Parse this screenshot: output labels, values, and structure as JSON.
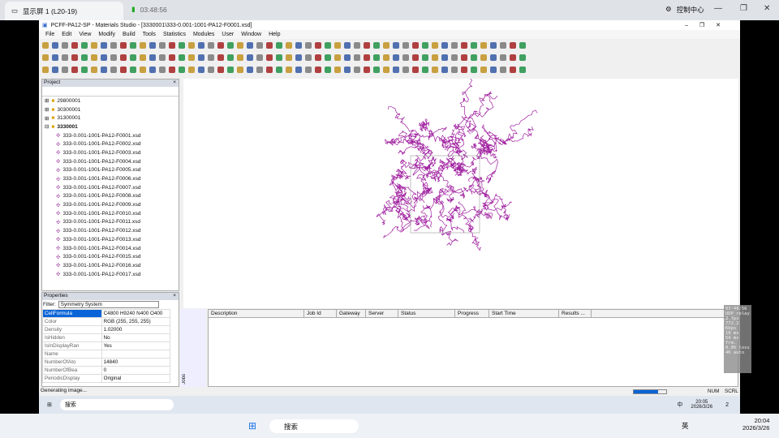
{
  "host": {
    "tab_label": "显示屏 1 (L20-19)",
    "tab_time": "03:48:56",
    "control_center": "控制中心",
    "clock_time": "20:04",
    "clock_date": "2026/3/26",
    "lang": "英"
  },
  "window": {
    "title": "PCFF-PA12-SP - Materials Studio - [3330001\\333-0.001-1001-PA12-F0001.xsd]",
    "menu": [
      "File",
      "Edit",
      "View",
      "Modify",
      "Build",
      "Tools",
      "Statistics",
      "Modules",
      "User",
      "Window",
      "Help"
    ]
  },
  "project": {
    "title": "Project",
    "folders": [
      "29800001",
      "30300001",
      "31300001",
      "3330001"
    ],
    "files": [
      "333-0.001-1001-PA12-F0001.xsd",
      "333-0.001-1001-PA12-F0002.xsd",
      "333-0.001-1001-PA12-F0003.xsd",
      "333-0.001-1001-PA12-F0004.xsd",
      "333-0.001-1001-PA12-F0005.xsd",
      "333-0.001-1001-PA12-F0006.xsd",
      "333-0.001-1001-PA12-F0007.xsd",
      "333-0.001-1001-PA12-F0008.xsd",
      "333-0.001-1001-PA12-F0009.xsd",
      "333-0.001-1001-PA12-F0010.xsd",
      "333-0.001-1001-PA12-F0011.xsd",
      "333-0.001-1001-PA12-F0012.xsd",
      "333-0.001-1001-PA12-F0013.xsd",
      "333-0.001-1001-PA12-F0014.xsd",
      "333-0.001-1001-PA12-F0015.xsd",
      "333-0.001-1001-PA12-F0016.xsd",
      "333-0.001-1001-PA12-F0017.xsd"
    ]
  },
  "properties": {
    "title": "Properties",
    "filter_label": "Filter:",
    "filter_value": "Symmetry System",
    "rows": [
      [
        "CellFormula",
        "C4800 H9240 N400 O400"
      ],
      [
        "Color",
        "RGB (255, 255, 255)"
      ],
      [
        "Density",
        "1.02000"
      ],
      [
        "IsHidden",
        "No"
      ],
      [
        "IsInDisplayRan",
        "Yes"
      ],
      [
        "Name",
        ""
      ],
      [
        "NumberOfAto",
        "14840"
      ],
      [
        "NumberOfBea",
        "0"
      ],
      [
        "PeriodicDisplay",
        "Original"
      ]
    ]
  },
  "jobs": {
    "tab": "Jobs",
    "columns": [
      "Description",
      "Job Id",
      "Gateway",
      "Server",
      "Status",
      "Progress",
      "Start Time",
      "Results ..."
    ]
  },
  "status": {
    "text": "Generating image...",
    "num": "NUM",
    "scrl": "SCRL",
    "progress": 0.75
  },
  "remote_taskbar": {
    "search": "搜索",
    "time": "20:05",
    "date": "2026/3/26",
    "ime": "中",
    "notifications": "2"
  },
  "overlay": [
    "03:48:56",
    "UDP relay",
    "2 fps",
    "772.2 Kbps",
    "18 ms",
    "54 ms frm.",
    "0.0% loss",
    "4K auto"
  ],
  "host_taskbar": {
    "search": "搜索"
  },
  "colors": {
    "molecule": "#a020a0",
    "selection": "#0a64d8"
  }
}
